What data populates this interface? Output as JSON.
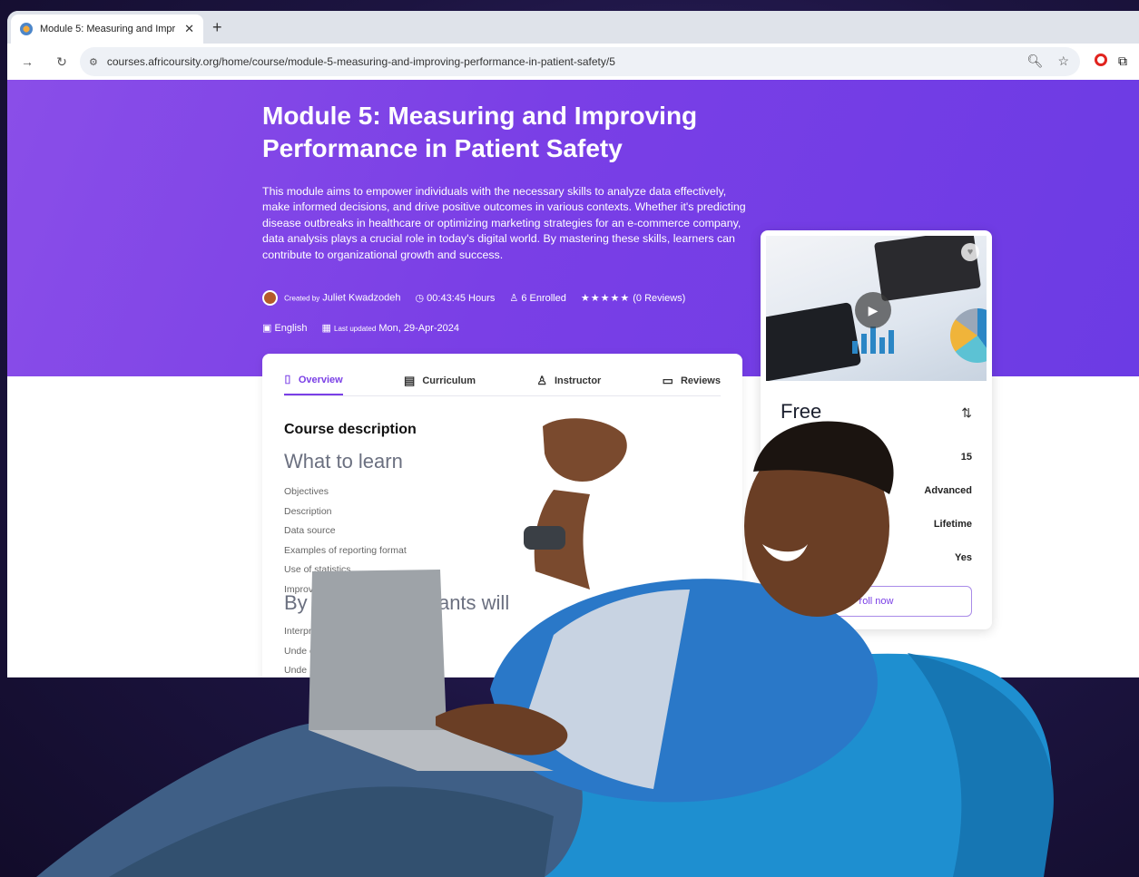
{
  "browser": {
    "tab_title": "Module 5: Measuring and Impr",
    "url": "courses.africoursity.org/home/course/module-5-measuring-and-improving-performance-in-patient-safety/5"
  },
  "hero": {
    "title": "Module 5: Measuring and Improving Performance in Patient Safety",
    "description": "This module aims to empower individuals with the necessary skills to analyze data effectively, make informed decisions, and drive positive outcomes in various contexts. Whether it's predicting disease outbreaks in healthcare or optimizing marketing strategies for an e-commerce company, data analysis plays a crucial role in today's digital world. By mastering these skills, learners can contribute to organizational growth and success.",
    "created_by_label": "Created by",
    "author": "Juliet Kwadzodeh",
    "duration": "00:43:45 Hours",
    "enrolled": "6 Enrolled",
    "rating_stars": 5,
    "reviews": "(0 Reviews)",
    "language": "English",
    "last_updated_label": "Last updated",
    "last_updated": "Mon, 29-Apr-2024"
  },
  "tabs": [
    "Overview",
    "Curriculum",
    "Instructor",
    "Reviews"
  ],
  "content": {
    "section_title": "Course description",
    "learn_heading": "What to learn",
    "learn_items": [
      "Objectives",
      "Description",
      "Data source",
      "Examples of reporting format",
      "Use of statistics",
      "Improv"
    ],
    "by_heading": "By                      he mod      articipants will",
    "outcome_items": [
      "Interpr                                       onclusions",
      "Unde                                    es of patient",
      "Unde                                   acilitate decis"
    ]
  },
  "sidebar": {
    "price": "Free",
    "rows": [
      "15",
      "Advanced",
      "Lifetime",
      "Yes"
    ],
    "enroll_label": "roll now"
  },
  "icons": {
    "play": "play-icon",
    "heart": "heart-icon",
    "share": "share-icon"
  },
  "colors": {
    "brand_purple": "#7a3fe6"
  }
}
